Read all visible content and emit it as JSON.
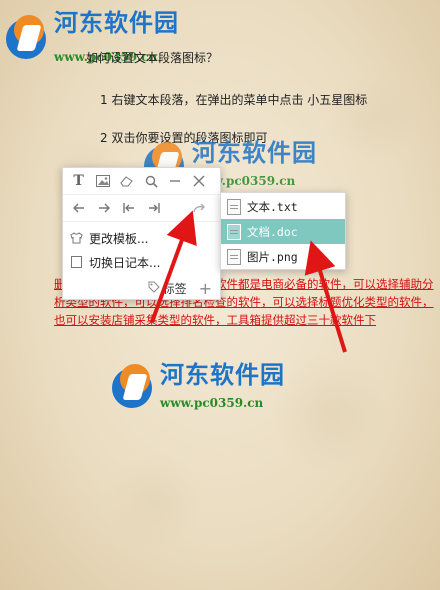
{
  "watermark": {
    "name": "河东软件园",
    "url": "www.pc0359.cn"
  },
  "content": {
    "question": "如何设置文本段落图标？",
    "step1": "1 右键文本段落，在弹出的菜单中点击 小五星图标",
    "step2": "2 双击你要设置的段落图标即可",
    "red_paragraph": "删除，便于你安装使用，大部分软件都是电商必备的软件，可以选择辅助分析类型的软件，可以选择排名检查的软件，可以选择标题优化类型的软件，也可以安装店铺采集类型的软件，工具箱提供超过三十款软件下"
  },
  "popup": {
    "toolbar_icons": [
      "text-icon",
      "image-icon",
      "eraser-icon",
      "search-icon",
      "minimize-icon",
      "close-icon"
    ],
    "nav_icons": [
      "arrow-left-icon",
      "arrow-right-icon",
      "indent-left-icon",
      "indent-right-icon",
      "redo-icon"
    ],
    "menu": [
      {
        "label": "更改模板..."
      },
      {
        "label": "切换日记本..."
      }
    ],
    "tag_label": "标签"
  },
  "submenu": {
    "items": [
      {
        "label": "文本.txt",
        "selected": false
      },
      {
        "label": "文档.doc",
        "selected": true
      },
      {
        "label": "图片.png",
        "selected": false
      }
    ]
  },
  "colors": {
    "accent_red": "#d51111",
    "selected_bg": "#7fc8c0",
    "watermark_blue": "#1e74c8",
    "watermark_green": "#2a8a2a"
  }
}
